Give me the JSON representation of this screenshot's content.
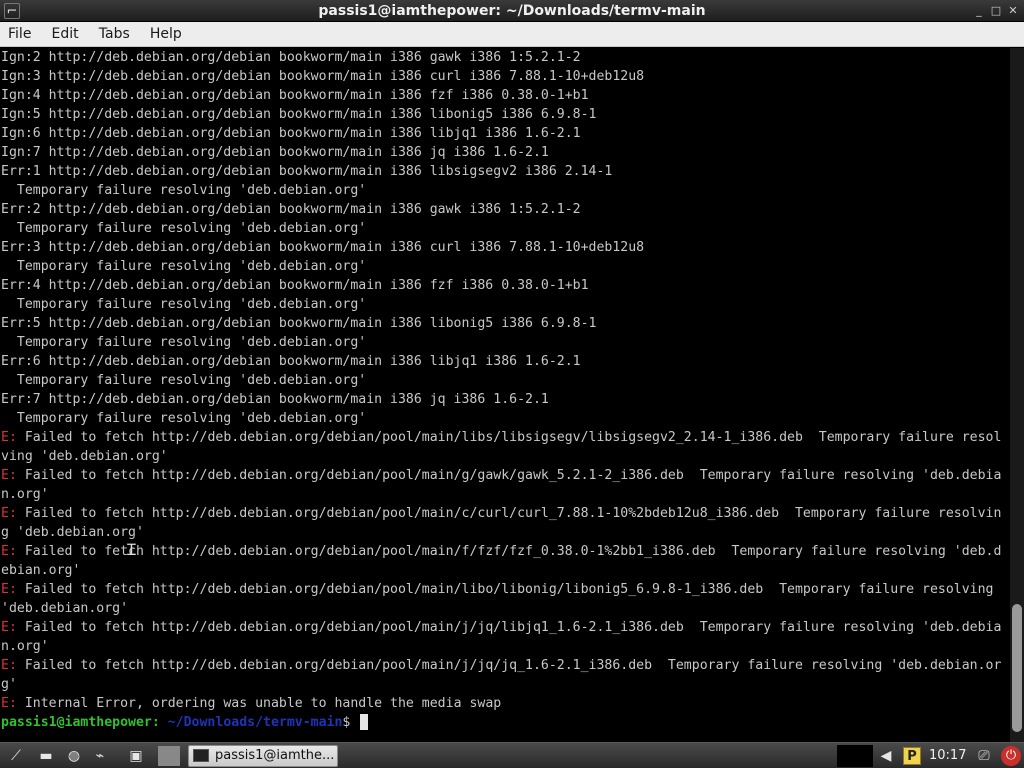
{
  "window": {
    "title": "passis1@iamthepower: ~/Downloads/termv-main",
    "controls": {
      "minimize": "_",
      "maximize": "□",
      "close": "✕"
    }
  },
  "menu": [
    "File",
    "Edit",
    "Tabs",
    "Help"
  ],
  "terminal": {
    "lines": [
      {
        "text": "Ign:2 http://deb.debian.org/debian bookworm/main i386 gawk i386 1:5.2.1-2"
      },
      {
        "text": "Ign:3 http://deb.debian.org/debian bookworm/main i386 curl i386 7.88.1-10+deb12u8"
      },
      {
        "text": "Ign:4 http://deb.debian.org/debian bookworm/main i386 fzf i386 0.38.0-1+b1"
      },
      {
        "text": "Ign:5 http://deb.debian.org/debian bookworm/main i386 libonig5 i386 6.9.8-1"
      },
      {
        "text": "Ign:6 http://deb.debian.org/debian bookworm/main i386 libjq1 i386 1.6-2.1"
      },
      {
        "text": "Ign:7 http://deb.debian.org/debian bookworm/main i386 jq i386 1.6-2.1"
      },
      {
        "text": "Err:1 http://deb.debian.org/debian bookworm/main i386 libsigsegv2 i386 2.14-1"
      },
      {
        "text": "  Temporary failure resolving 'deb.debian.org'"
      },
      {
        "text": "Err:2 http://deb.debian.org/debian bookworm/main i386 gawk i386 1:5.2.1-2"
      },
      {
        "text": "  Temporary failure resolving 'deb.debian.org'"
      },
      {
        "text": "Err:3 http://deb.debian.org/debian bookworm/main i386 curl i386 7.88.1-10+deb12u8"
      },
      {
        "text": "  Temporary failure resolving 'deb.debian.org'"
      },
      {
        "text": "Err:4 http://deb.debian.org/debian bookworm/main i386 fzf i386 0.38.0-1+b1"
      },
      {
        "text": "  Temporary failure resolving 'deb.debian.org'"
      },
      {
        "text": "Err:5 http://deb.debian.org/debian bookworm/main i386 libonig5 i386 6.9.8-1"
      },
      {
        "text": "  Temporary failure resolving 'deb.debian.org'"
      },
      {
        "text": "Err:6 http://deb.debian.org/debian bookworm/main i386 libjq1 i386 1.6-2.1"
      },
      {
        "text": "  Temporary failure resolving 'deb.debian.org'"
      },
      {
        "text": "Err:7 http://deb.debian.org/debian bookworm/main i386 jq i386 1.6-2.1"
      },
      {
        "text": "  Temporary failure resolving 'deb.debian.org'"
      },
      {
        "prefix": "E:",
        "text": " Failed to fetch http://deb.debian.org/debian/pool/main/libs/libsigsegv/libsigsegv2_2.14-1_i386.deb  Temporary failure resol"
      },
      {
        "text": "ving 'deb.debian.org'"
      },
      {
        "prefix": "E:",
        "text": " Failed to fetch http://deb.debian.org/debian/pool/main/g/gawk/gawk_5.2.1-2_i386.deb  Temporary failure resolving 'deb.debia"
      },
      {
        "text": "n.org'"
      },
      {
        "prefix": "E:",
        "text": " Failed to fetch http://deb.debian.org/debian/pool/main/c/curl/curl_7.88.1-10%2bdeb12u8_i386.deb  Temporary failure resolvin"
      },
      {
        "text": "g 'deb.debian.org'"
      },
      {
        "prefix": "E:",
        "text": " Failed to fetch http://deb.debian.org/debian/pool/main/f/fzf/fzf_0.38.0-1%2bb1_i386.deb  Temporary failure resolving 'deb.d"
      },
      {
        "text": "ebian.org'"
      },
      {
        "prefix": "E:",
        "text": " Failed to fetch http://deb.debian.org/debian/pool/main/libo/libonig/libonig5_6.9.8-1_i386.deb  Temporary failure resolving "
      },
      {
        "text": "'deb.debian.org'"
      },
      {
        "prefix": "E:",
        "text": " Failed to fetch http://deb.debian.org/debian/pool/main/j/jq/libjq1_1.6-2.1_i386.deb  Temporary failure resolving 'deb.debia"
      },
      {
        "text": "n.org'"
      },
      {
        "prefix": "E:",
        "text": " Failed to fetch http://deb.debian.org/debian/pool/main/j/jq/jq_1.6-2.1_i386.deb  Temporary failure resolving 'deb.debian.or"
      },
      {
        "text": "g'"
      },
      {
        "prefix": "E:",
        "text": " Internal Error, ordering was unable to handle the media swap"
      }
    ],
    "prompt": {
      "user_host": "passis1@iamthepower:",
      "path": " ~/Downloads/termv-main",
      "symbol": "$ "
    }
  },
  "taskbar": {
    "window_button": "passis1@iamthe...",
    "clock": "10:17",
    "p_badge": "P"
  },
  "colors": {
    "error_prefix": "#d13535",
    "prompt_user": "#2fc12f",
    "prompt_path": "#1f33b8"
  }
}
